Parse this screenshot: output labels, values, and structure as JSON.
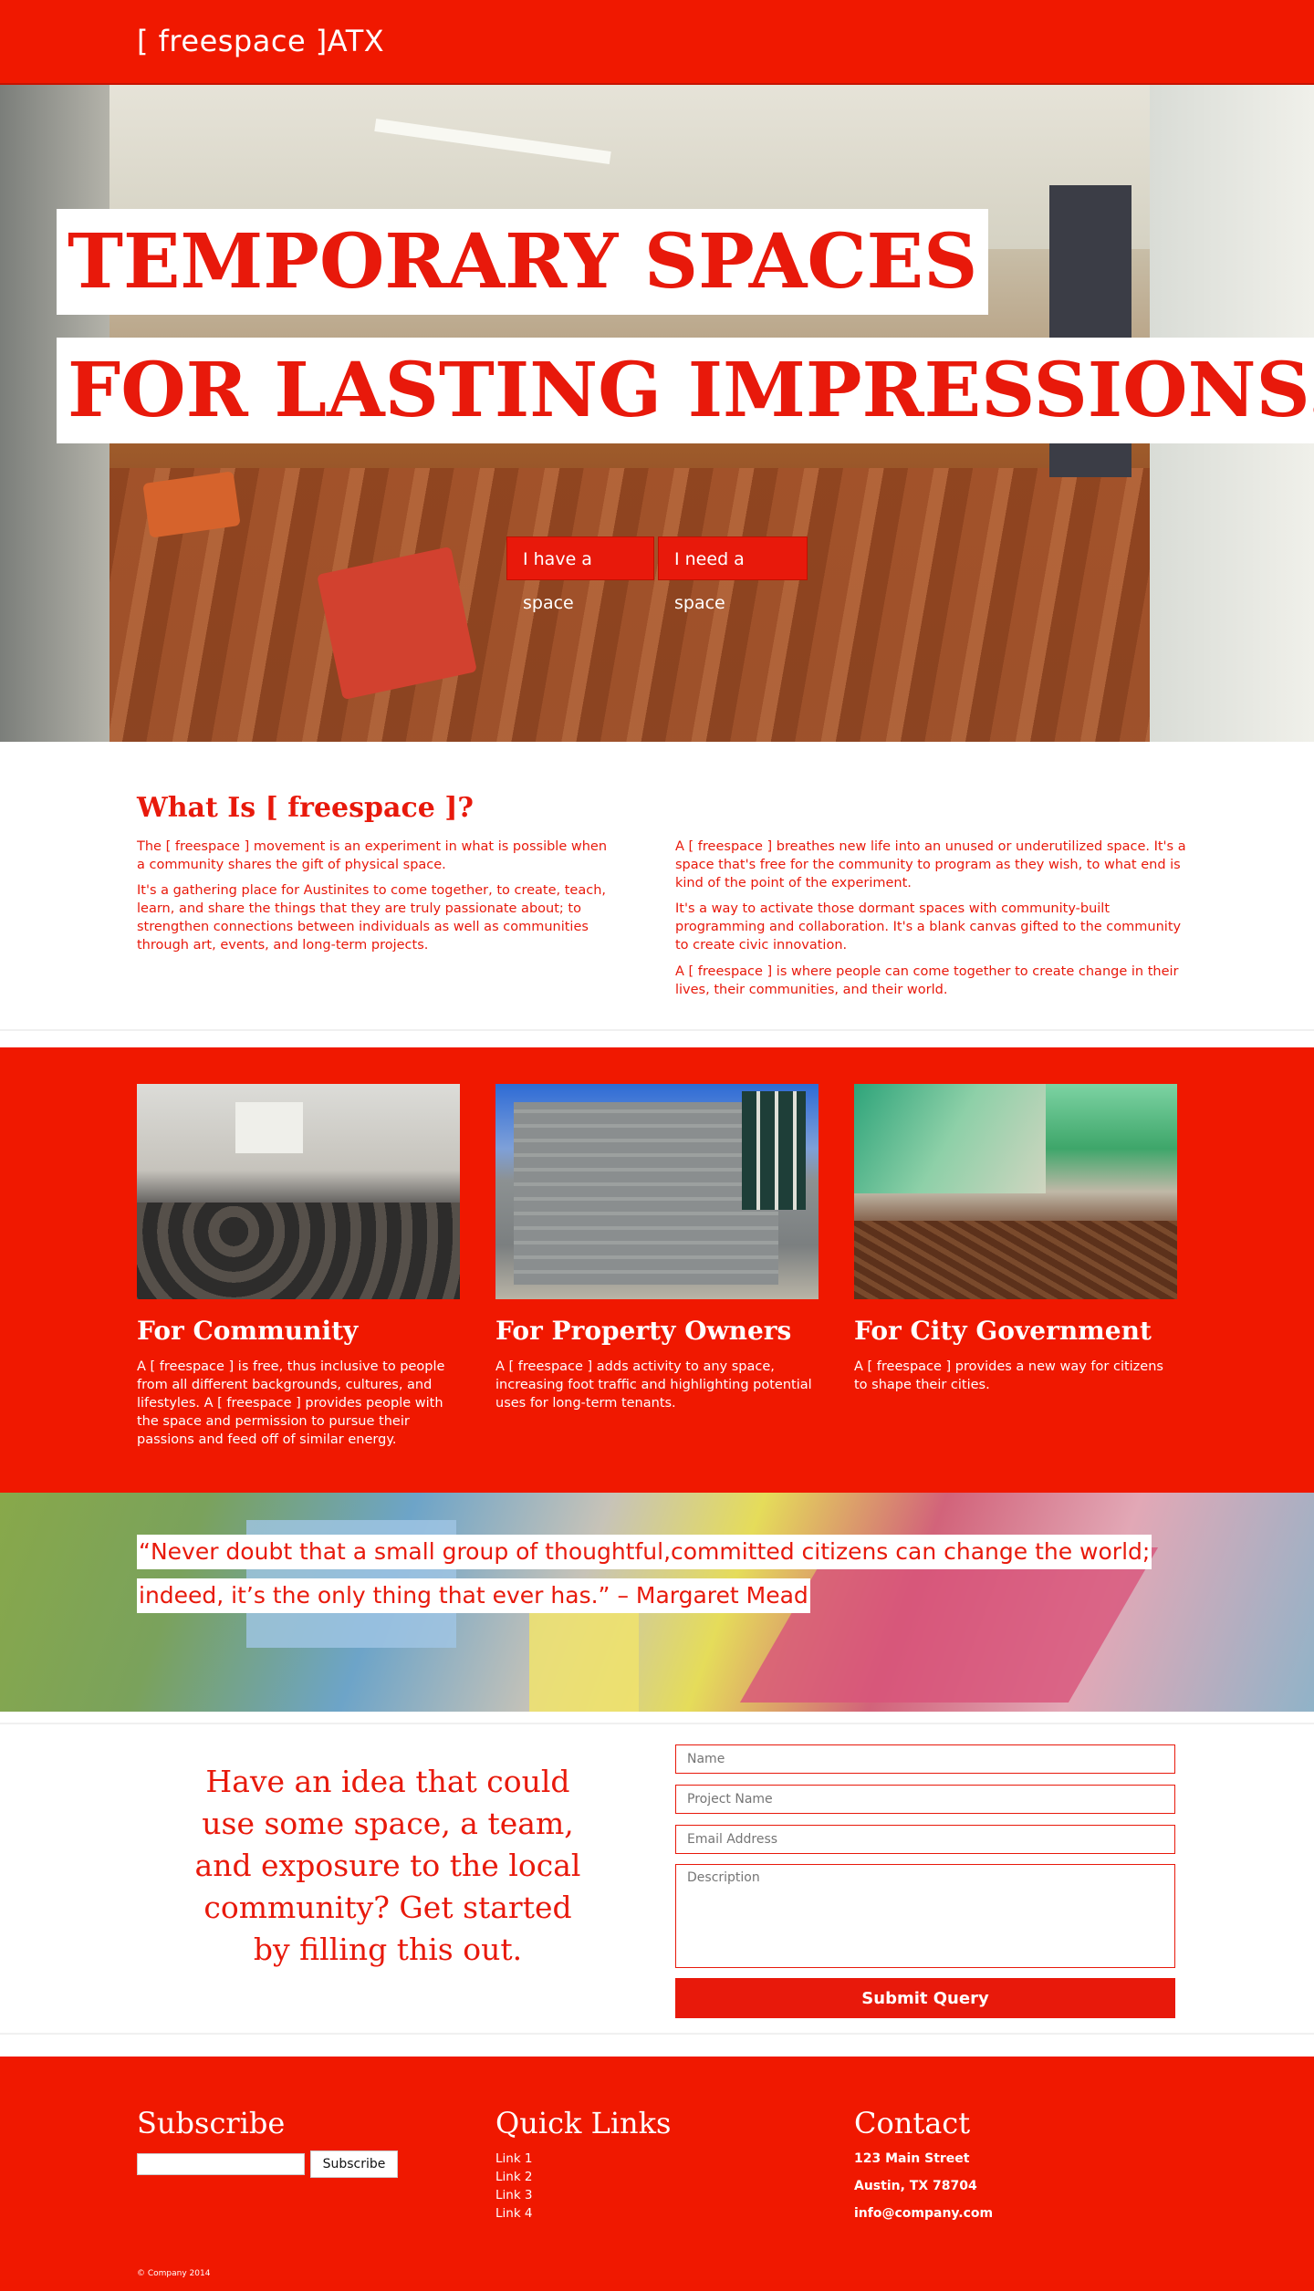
{
  "nav": {
    "brand": "[ freespace ]ATX"
  },
  "hero": {
    "headline_1": "TEMPORARY SPACES",
    "headline_2": "FOR LASTING IMPRESSIONS.",
    "buttons": [
      "I have a space",
      "I need a space"
    ]
  },
  "about": {
    "title": "What Is [ freespace ]?",
    "left": [
      "The [ freespace ] movement is an experiment in what is possible when a community shares the gift of physical space.",
      "It's a gathering place for Austinites to come together, to create, teach, learn, and share the things that they are truly passionate about; to strengthen connections between individuals as well as communities through art, events, and long-term projects."
    ],
    "right": [
      "A [ freespace ] breathes new life into an unused or underutilized space. It's a space that's free for the community to program as they wish, to what end is kind of the point of the experiment.",
      "It's a way to activate those dormant spaces with community-built programming and collaboration. It's a blank canvas gifted to the community to create civic innovation.",
      "A [ freespace ] is where people can come together to create change in their lives, their communities, and their world."
    ]
  },
  "features": [
    {
      "title": "For Community",
      "text": "A [ freespace ] is free, thus inclusive to people from all different backgrounds, cultures, and lifestyles. A [ freespace ] provides people with the space and permission to pursue their passions and feed off of similar energy."
    },
    {
      "title": "For Property Owners",
      "text": "A [ freespace ] adds activity to any space, increasing foot traffic and highlighting potential uses for long-term tenants."
    },
    {
      "title": "For City Government",
      "text": "A [ freespace ] provides a new way for citizens to shape their cities."
    }
  ],
  "quote": {
    "line_1": "“Never doubt that a small group of thoughtful,committed citizens can change the world;",
    "line_2": "indeed, it’s the only thing that ever has.” – Margaret Mead"
  },
  "form": {
    "cta": "Have an idea that could use some space, a team, and exposure to the local community? Get started by filling this out.",
    "placeholders": {
      "name": "Name",
      "project": "Project Name",
      "email": "Email Address",
      "description": "Description"
    },
    "submit": "Submit Query"
  },
  "footer": {
    "subscribe_title": "Subscribe",
    "subscribe_button": "Subscribe",
    "links_title": "Quick Links",
    "links": [
      "Link 1",
      "Link 2",
      "Link 3",
      "Link 4"
    ],
    "contact_title": "Contact",
    "contact": [
      "123 Main Street",
      "Austin, TX 78704",
      "info@company.com"
    ],
    "copyright": "© Company 2014"
  },
  "colors": {
    "brand_red": "#f01800",
    "white": "#ffffff"
  }
}
